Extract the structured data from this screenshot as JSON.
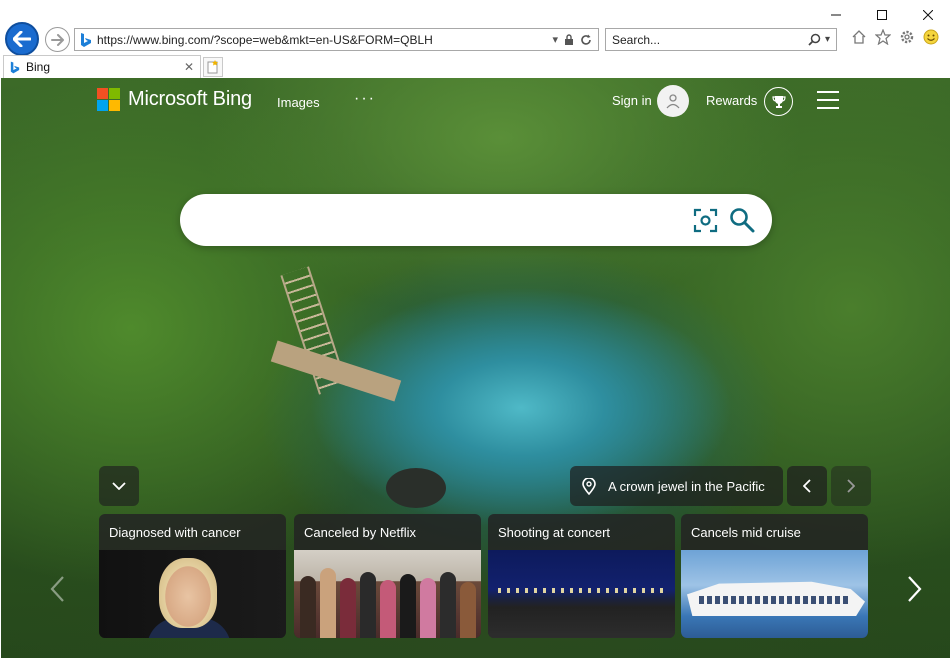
{
  "browser": {
    "address": {
      "url": "https://www.bing.com/?scope=web&mkt=en-US&FORM=QBLH"
    },
    "search": {
      "placeholder": "Search..."
    },
    "tab": {
      "title": "Bing"
    },
    "window_controls": [
      "minimize",
      "maximize",
      "close"
    ],
    "toolbar_icons": [
      "home-icon",
      "favorites-star-icon",
      "settings-gear-icon",
      "feedback-smiley-icon"
    ]
  },
  "bing": {
    "brand": "Microsoft Bing",
    "nav": {
      "images": "Images",
      "more": "···"
    },
    "account": {
      "sign_in": "Sign in",
      "rewards": "Rewards"
    },
    "search": {
      "value": ""
    },
    "image_info": {
      "title": "A crown jewel in the Pacific"
    },
    "cards": [
      {
        "title": "Diagnosed with cancer"
      },
      {
        "title": "Canceled by Netflix"
      },
      {
        "title": "Shooting at concert"
      },
      {
        "title": "Cancels mid cruise"
      }
    ]
  },
  "colors": {
    "accent_blue": "#1a6bcf",
    "search_icon_teal": "#0f6c81",
    "ms_red": "#f25022",
    "ms_green": "#7fba00",
    "ms_blue": "#00a4ef",
    "ms_yellow": "#ffb900"
  }
}
